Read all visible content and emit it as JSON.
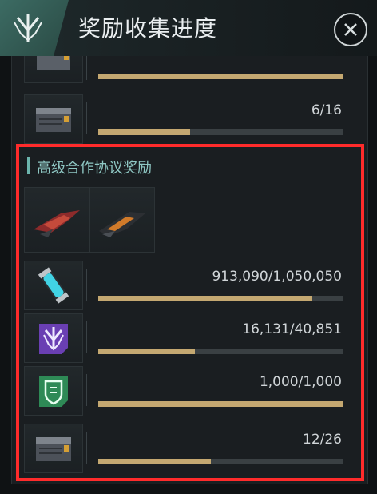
{
  "header": {
    "title": "奖励收集进度",
    "icons": {
      "logo": "faction-logo-icon",
      "close": "close-icon"
    }
  },
  "top_rows": [
    {
      "icon": "crate-icon",
      "count": "",
      "progress": 1.0
    },
    {
      "icon": "crate-icon",
      "count": "6/16",
      "progress": 0.375
    }
  ],
  "section": {
    "title": "高级合作协议奖励",
    "ships": [
      {
        "icon": "red-ship-icon"
      },
      {
        "icon": "dark-ship-icon"
      }
    ],
    "rows": [
      {
        "icon": "energy-capsule-icon",
        "count": "913,090/1,050,050",
        "progress": 0.87
      },
      {
        "icon": "purple-emblem-icon",
        "count": "16,131/40,851",
        "progress": 0.395
      },
      {
        "icon": "green-emblem-icon",
        "count": "1,000/1,000",
        "progress": 1.0
      },
      {
        "icon": "crate-icon",
        "count": "12/26",
        "progress": 0.46
      }
    ]
  },
  "colors": {
    "bar_fill": "#c4a871",
    "highlight_frame": "#ff2b2b",
    "section_title": "#8fc8c4"
  }
}
